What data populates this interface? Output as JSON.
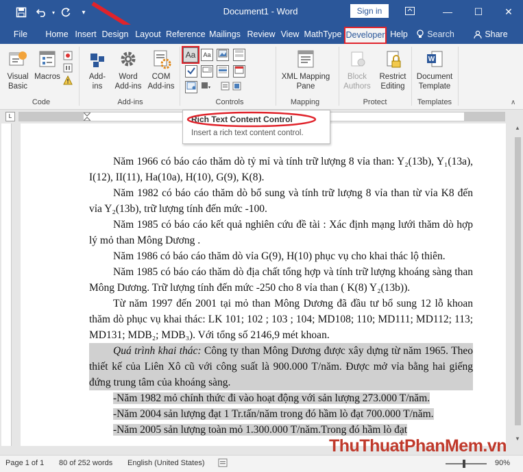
{
  "titlebar": {
    "title": "Document1  -  Word",
    "sign_in": "Sign in"
  },
  "tabs": [
    {
      "label": "File"
    },
    {
      "label": "Home"
    },
    {
      "label": "Insert"
    },
    {
      "label": "Design"
    },
    {
      "label": "Layout"
    },
    {
      "label": "Reference"
    },
    {
      "label": "Mailings"
    },
    {
      "label": "Review"
    },
    {
      "label": "View"
    },
    {
      "label": "MathType"
    },
    {
      "label": "Developer"
    },
    {
      "label": "Help"
    }
  ],
  "search": {
    "label": "Search"
  },
  "share": {
    "label": "Share"
  },
  "ribbon": {
    "code": {
      "label": "Code",
      "visual_basic": "Visual\nBasic",
      "macros": "Macros"
    },
    "addins": {
      "label": "Add-ins",
      "addins": "Add-\nins",
      "word_addins": "Word\nAdd-ins",
      "com_addins": "COM\nAdd-ins"
    },
    "controls": {
      "label": "Controls"
    },
    "mapping": {
      "label": "Mapping",
      "xml_pane": "XML Mapping\nPane"
    },
    "protect": {
      "label": "Protect",
      "block_authors": "Block\nAuthors",
      "restrict_editing": "Restrict\nEditing"
    },
    "templates": {
      "label": "Templates",
      "document_template": "Document\nTemplate"
    }
  },
  "tooltip": {
    "title": "Rich Text Content Control",
    "body": "Insert a rich text content control."
  },
  "document": {
    "p1": "Năm 1966 có báo cáo thăm dò tỷ mỉ và tính trữ lượng 8 vỉa than: Y₂(13b), Y₁(13a), I(12), II(11), Ha(10a), H(10), G(9), K(8).",
    "p2": "Năm 1982 có báo cáo thăm dò bổ sung và tính trữ lượng 8 vỉa than từ vỉa K8 đến vỉa Y₂(13b), trữ lượng tính đến mức -100.",
    "p3": "Năm 1985 có báo cáo kết quả nghiên cứu đề tài : Xác định mạng lưới thăm dò hợp lý mỏ than Mông Dương .",
    "p4": "Năm 1986 có báo cáo thăm dò vỉa G(9), H(10) phục vụ cho khai thác lộ thiên.",
    "p5": "Năm 1985 có báo cáo thăm dò địa chất tổng hợp và tính trữ  lượng khoáng sàng than Mông Dương. Trữ lượng tính đến mức -250 cho 8 vỉa than ( K(8)  Y₂(13b)).",
    "p6": "Từ năm 1997 đến 2001 tại mỏ than Mông Dương đã đầu tư bổ sung 12 lỗ khoan thăm dò phục vụ khai thác: LK 101; 102 ; 103 ; 104; MD108; 110; MD111; MD112; 113; MD131; MDB₂; MDB₃). Với tổng số 2146,9 mét khoan.",
    "p7_italic": "Quá trình khai thác:",
    "p7_rest": "  Công ty than Mông Dương được xây dựng từ  năm 1965. Theo thiết kế của Liên Xô cũ với công suất là 900.000 T/năm. Được mở vỉa bằng hai giếng đứng trung tâm của khoáng sàng.",
    "b1": "-Năm 1982 mỏ chính thức đi vào hoạt động với sản lượng 273.000 T/năm.",
    "b2": "-Năm 2004 sản lượng đạt 1 Tr.tấn/năm trong đó hầm lò đạt  700.000 T/năm.",
    "b3": "-Năm 2005 sản lượng toàn mỏ 1.300.000 T/năm.Trong đó hầm lò đạt"
  },
  "status": {
    "page": "Page 1 of 1",
    "words": "80 of 252 words",
    "language": "English (United States)",
    "zoom": "90%"
  },
  "watermark": {
    "text": "ThuThuatPhanMem.vn"
  },
  "colors": {
    "accent": "#2b579a",
    "highlight_red": "#e0232b",
    "selection": "#d0d0d0"
  }
}
